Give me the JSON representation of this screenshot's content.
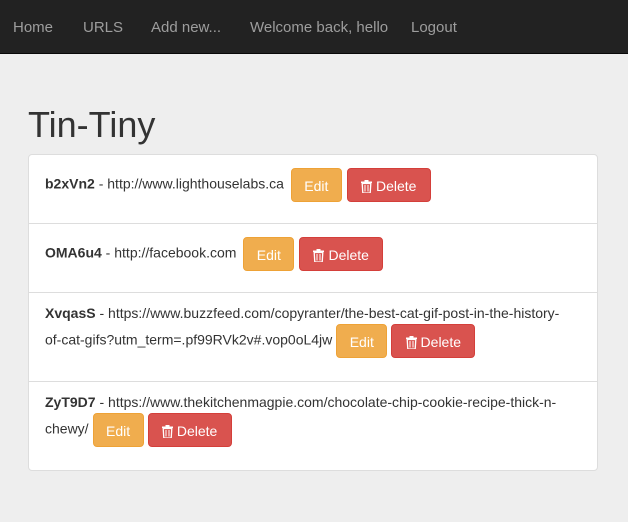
{
  "nav": {
    "items": [
      {
        "label": "Home"
      },
      {
        "label": "URLS"
      },
      {
        "label": "Add new..."
      },
      {
        "label": "Welcome back, hello"
      },
      {
        "label": "Logout"
      }
    ]
  },
  "page": {
    "title": "Tin-Tiny"
  },
  "urls": [
    {
      "code": "b2xVn2",
      "separator": " - ",
      "long_url_line1": "http://www.lighthouselabs.ca",
      "long_url_line2": ""
    },
    {
      "code": "OMA6u4",
      "separator": " - ",
      "long_url_line1": "http://facebook.com",
      "long_url_line2": ""
    },
    {
      "code": "XvqasS",
      "separator": " - ",
      "long_url_line1": "https://www.buzzfeed.com/copyranter/the-best-cat-gif-post-in-the-history-",
      "long_url_line2": "of-cat-gifs?utm_term=.pf99RVk2v#.vop0oL4jw"
    },
    {
      "code": "ZyT9D7",
      "separator": " - ",
      "long_url_line1": "https://www.thekitchenmagpie.com/chocolate-chip-cookie-recipe-thick-n-",
      "long_url_line2": "chewy/"
    }
  ],
  "buttons": {
    "edit_label": "Edit",
    "delete_label": "Delete"
  },
  "colors": {
    "navbar_bg": "#222222",
    "nav_text": "#9d9d9d",
    "page_bg": "#eeeeee",
    "edit_button": "#f0ad4e",
    "delete_button": "#d9534f"
  },
  "icons": {
    "delete": "trash-icon"
  }
}
